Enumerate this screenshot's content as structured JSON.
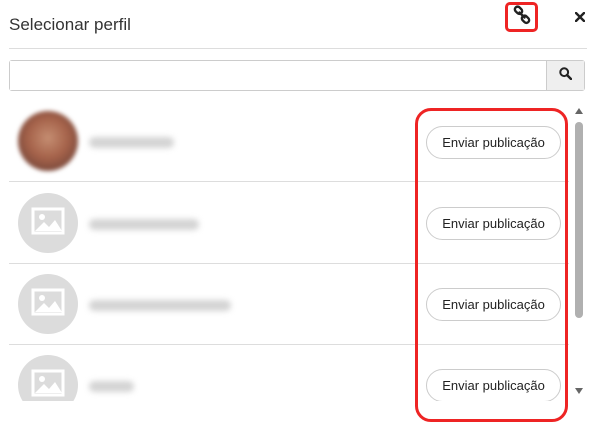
{
  "header": {
    "title": "Selecionar perfil",
    "link_icon": "link-chain-icon",
    "close_icon": "close-icon"
  },
  "search": {
    "value": "",
    "placeholder": "",
    "icon": "search-icon"
  },
  "profiles": [
    {
      "avatar": "photo",
      "send_label": "Enviar publicação"
    },
    {
      "avatar": "image-placeholder",
      "send_label": "Enviar publicação"
    },
    {
      "avatar": "image-placeholder",
      "send_label": "Enviar publicação"
    },
    {
      "avatar": "image-placeholder",
      "send_label": "Enviar publicação"
    }
  ],
  "scrollbar": {
    "up_icon": "scroll-up-arrow-icon",
    "down_icon": "scroll-down-arrow-icon"
  },
  "colors": {
    "highlight": "#ee2424",
    "divider": "#dddddd",
    "placeholder_avatar": "#dcdcdc"
  }
}
